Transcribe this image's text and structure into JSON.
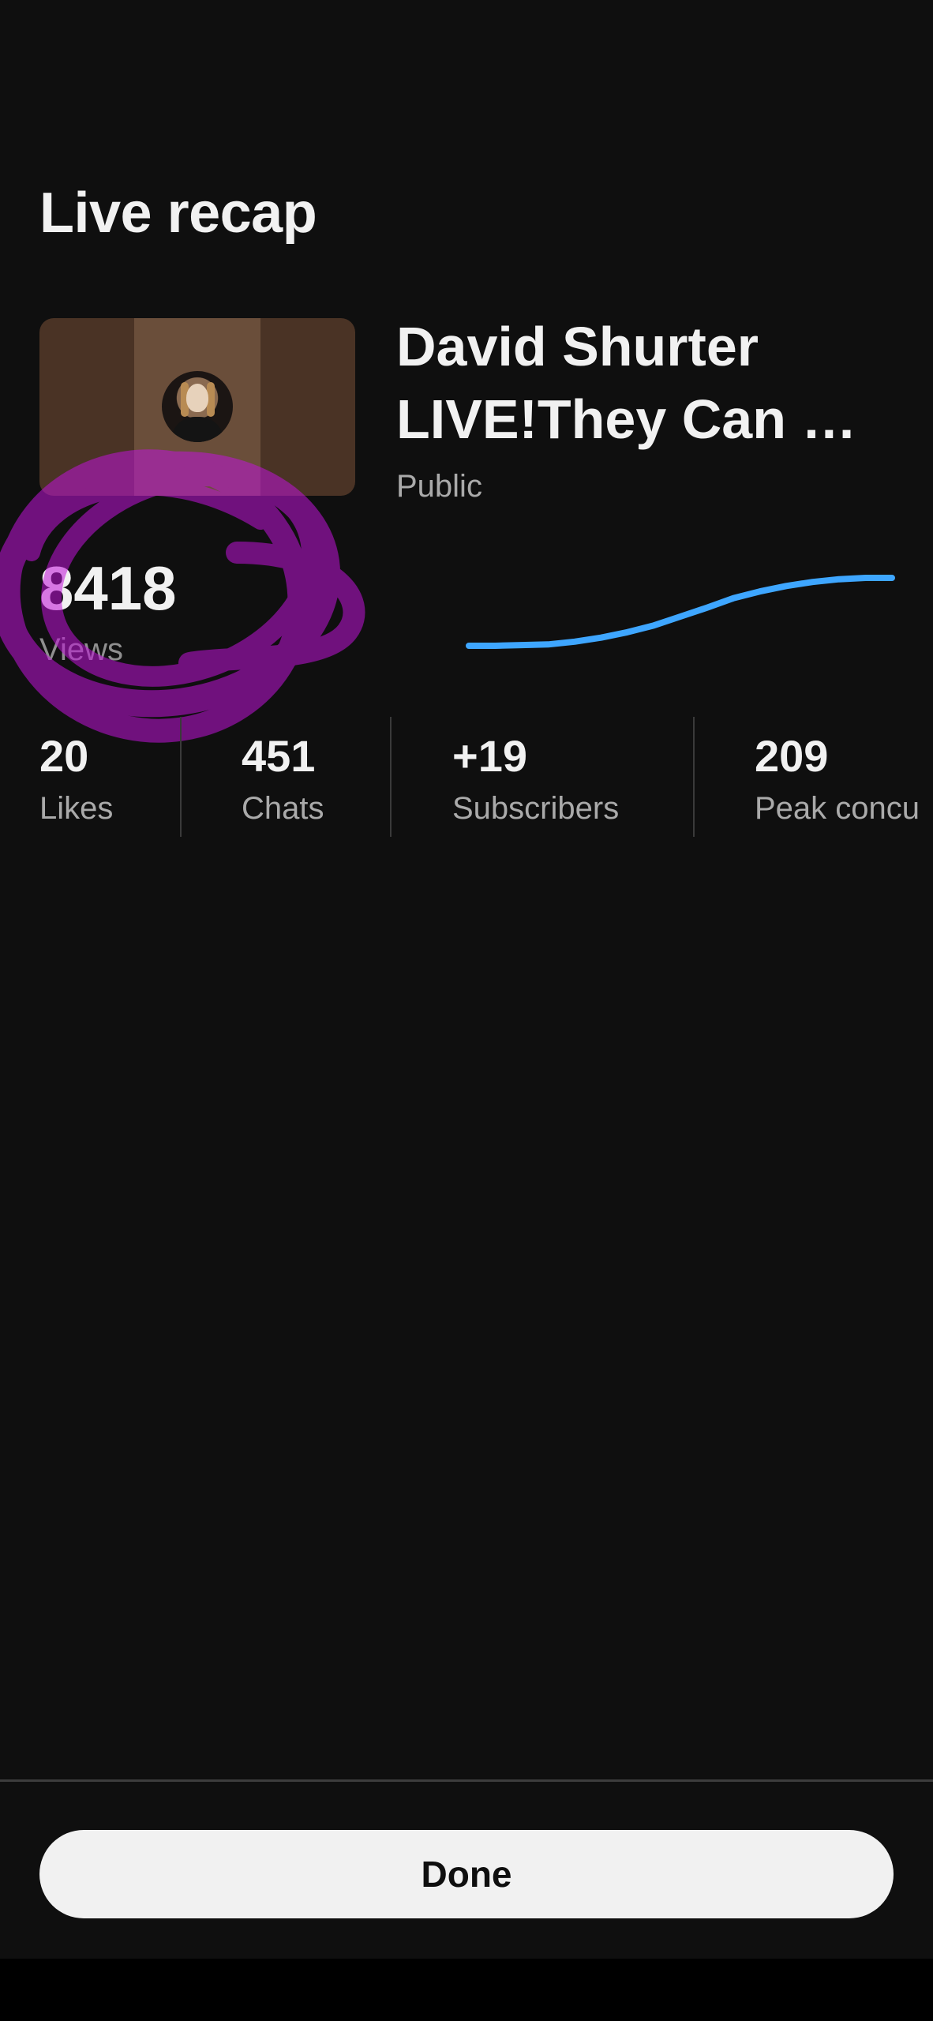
{
  "header": {
    "title": "Live recap"
  },
  "stream": {
    "title_line1": "David Shurter",
    "title_line2": "LIVE!They Can …",
    "visibility": "Public"
  },
  "views": {
    "count": "8418",
    "label": "Views",
    "trend": [
      0,
      0,
      0.01,
      0.02,
      0.06,
      0.12,
      0.2,
      0.3,
      0.43,
      0.56,
      0.7,
      0.8,
      0.88,
      0.94,
      0.98,
      1.0,
      1.0
    ]
  },
  "stats": [
    {
      "value": "20",
      "label": "Likes"
    },
    {
      "value": "451",
      "label": "Chats"
    },
    {
      "value": "+19",
      "label": "Subscribers"
    },
    {
      "value": "209",
      "label": "Peak concu"
    }
  ],
  "footer": {
    "done_label": "Done"
  },
  "colors": {
    "background": "#0f0f0f",
    "sparkline": "#3ea6ff",
    "annotation": "#c014d8",
    "button": "#f1f1f1"
  },
  "icons": {
    "thumbnail_avatar": "avatar-image"
  }
}
